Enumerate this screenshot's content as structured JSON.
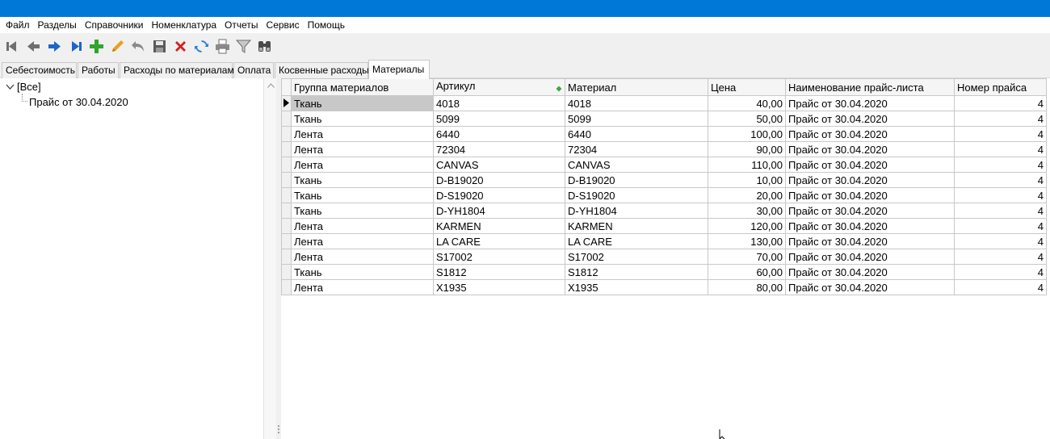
{
  "menu": [
    "Файл",
    "Разделы",
    "Справочники",
    "Номенклатура",
    "Отчеты",
    "Сервис",
    "Помощь"
  ],
  "toolbar": {
    "icons": [
      "first-record-icon",
      "prev-record-icon",
      "next-record-icon",
      "last-record-icon",
      "add-icon",
      "edit-icon",
      "undo-icon",
      "save-icon",
      "delete-icon",
      "refresh-icon",
      "print-icon",
      "filter-icon",
      "find-icon"
    ],
    "colors": {
      "nav": "#1e64c8",
      "nav_gray": "#6e6e6e",
      "add": "#2fa52f",
      "edit": "#e8a020",
      "delete": "#d42020",
      "refresh": "#2a7fd4"
    }
  },
  "tabs": [
    "Себестоимость",
    "Работы",
    "Расходы по материалам",
    "Оплата",
    "Косвенные расходы",
    "Материалы"
  ],
  "active_tab": "Материалы",
  "tree": {
    "root": "[Все]",
    "children": [
      "Прайс от 30.04.2020"
    ]
  },
  "grid": {
    "columns": [
      "Группа материалов",
      "Артикул",
      "Материал",
      "Цена",
      "Наименование прайс-листа",
      "Номер прайса"
    ],
    "rows": [
      [
        "Ткань",
        "4018",
        "4018",
        "40,00",
        "Прайс от 30.04.2020",
        "4"
      ],
      [
        "Ткань",
        "5099",
        "5099",
        "50,00",
        "Прайс от 30.04.2020",
        "4"
      ],
      [
        "Лента",
        "6440",
        "6440",
        "100,00",
        "Прайс от 30.04.2020",
        "4"
      ],
      [
        "Лента",
        "72304",
        "72304",
        "90,00",
        "Прайс от 30.04.2020",
        "4"
      ],
      [
        "Лента",
        "CANVAS",
        "CANVAS",
        "110,00",
        "Прайс от 30.04.2020",
        "4"
      ],
      [
        "Ткань",
        "D-B19020",
        "D-B19020",
        "10,00",
        "Прайс от 30.04.2020",
        "4"
      ],
      [
        "Ткань",
        "D-S19020",
        "D-S19020",
        "20,00",
        "Прайс от 30.04.2020",
        "4"
      ],
      [
        "Ткань",
        "D-YH1804",
        "D-YH1804",
        "30,00",
        "Прайс от 30.04.2020",
        "4"
      ],
      [
        "Лента",
        "KARMEN",
        "KARMEN",
        "120,00",
        "Прайс от 30.04.2020",
        "4"
      ],
      [
        "Лента",
        "LA CARE",
        "LA CARE",
        "130,00",
        "Прайс от 30.04.2020",
        "4"
      ],
      [
        "Лента",
        "S17002",
        "S17002",
        "70,00",
        "Прайс от 30.04.2020",
        "4"
      ],
      [
        "Ткань",
        "S1812",
        "S1812",
        "60,00",
        "Прайс от 30.04.2020",
        "4"
      ],
      [
        "Лента",
        "X1935",
        "X1935",
        "80,00",
        "Прайс от 30.04.2020",
        "4"
      ]
    ],
    "selected_row": 0,
    "sorted_column": "Артикул"
  }
}
